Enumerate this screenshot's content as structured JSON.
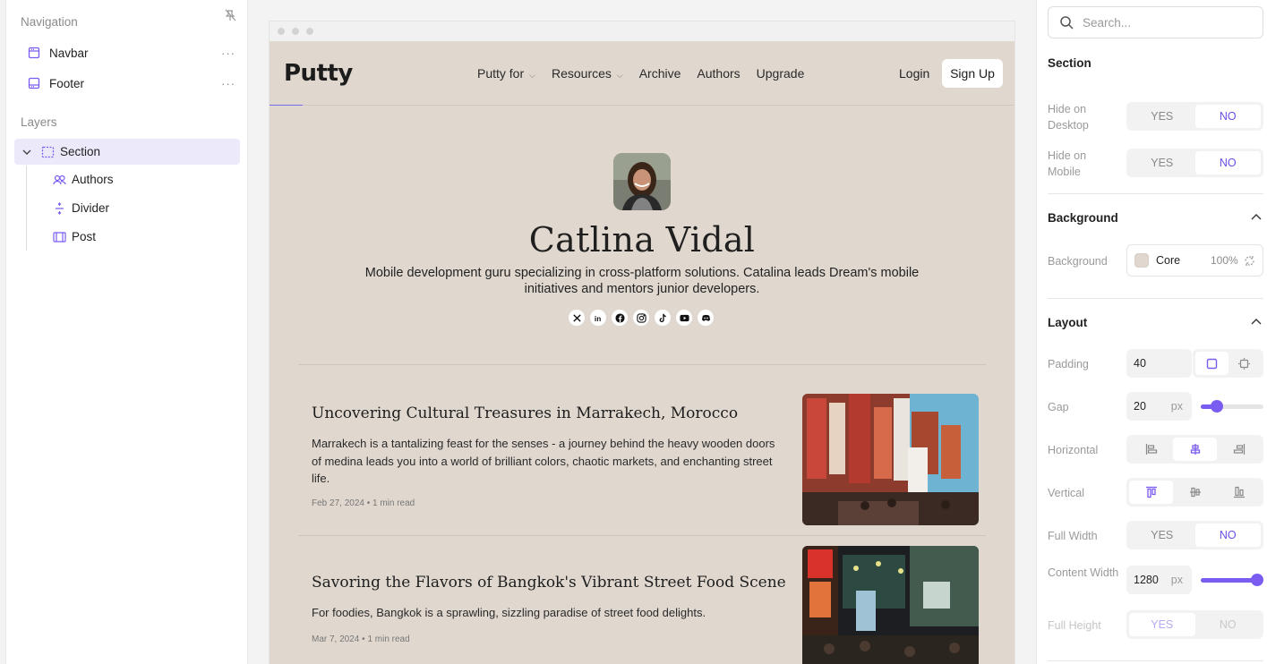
{
  "left_panel": {
    "navigation_heading": "Navigation",
    "nav_items": [
      {
        "label": "Navbar",
        "icon": "navbar-icon"
      },
      {
        "label": "Footer",
        "icon": "footer-icon"
      }
    ],
    "more": "···",
    "layers_heading": "Layers",
    "layers": [
      {
        "label": "Section",
        "icon": "section-icon",
        "selected": true
      },
      {
        "label": "Authors",
        "icon": "authors-icon"
      },
      {
        "label": "Divider",
        "icon": "divider-icon"
      },
      {
        "label": "Post",
        "icon": "post-icon"
      }
    ]
  },
  "site": {
    "logo": "Putty",
    "menu": [
      {
        "label": "Putty for",
        "dropdown": true
      },
      {
        "label": "Resources",
        "dropdown": true
      },
      {
        "label": "Archive",
        "dropdown": false
      },
      {
        "label": "Authors",
        "dropdown": false
      },
      {
        "label": "Upgrade",
        "dropdown": false
      }
    ],
    "login": "Login",
    "signup": "Sign Up",
    "author": {
      "name": "Catlina Vidal",
      "bio": "Mobile development guru specializing in cross-platform solutions. Catalina leads Dream's mobile initiatives and mentors junior developers.",
      "socials": [
        "x-icon",
        "linkedin-icon",
        "facebook-icon",
        "instagram-icon",
        "tiktok-icon",
        "youtube-icon",
        "discord-icon"
      ]
    },
    "posts": [
      {
        "title": "Uncovering Cultural Treasures in Marrakech, Morocco",
        "excerpt": "Marrakech is a tantalizing feast for the senses - a journey behind the heavy wooden doors of medina leads you into a world of brilliant colors, chaotic markets, and enchanting street life.",
        "date": "Feb 27, 2024",
        "read": "1 min read"
      },
      {
        "title": "Savoring the Flavors of Bangkok's Vibrant Street Food Scene",
        "excerpt": "For foodies, Bangkok is a sprawling, sizzling paradise of street food delights.",
        "date": "Mar 7, 2024",
        "read": "1 min read"
      }
    ]
  },
  "right_panel": {
    "search_placeholder": "Search...",
    "section_heading": "Section",
    "hide_desktop_label": "Hide on Desktop",
    "hide_mobile_label": "Hide on Mobile",
    "yes": "YES",
    "no": "NO",
    "background_heading": "Background",
    "background_label": "Background",
    "background_value": "Core",
    "background_opacity": "100%",
    "layout_heading": "Layout",
    "padding_label": "Padding",
    "padding_value": "40",
    "gap_label": "Gap",
    "gap_value": "20",
    "unit": "px",
    "horizontal_label": "Horizontal",
    "vertical_label": "Vertical",
    "full_width_label": "Full Width",
    "content_width_label": "Content Width",
    "content_width_value": "1280",
    "full_height_label": "Full Height",
    "gap_slider_fraction": 0.25,
    "content_width_slider_fraction": 1.0,
    "accent_color": "#7b5cf0"
  }
}
